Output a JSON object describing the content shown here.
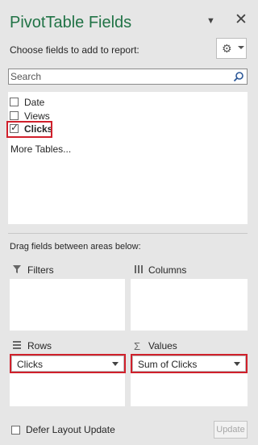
{
  "pane": {
    "title": "PivotTable Fields",
    "choose_label": "Choose fields to add to report:",
    "settings_icon": "gear-icon",
    "close_glyph": "✕"
  },
  "search": {
    "placeholder": "Search",
    "value": "",
    "icon": "search-icon"
  },
  "fields": [
    {
      "label": "Date",
      "checked": false
    },
    {
      "label": "Views",
      "checked": false
    },
    {
      "label": "Clicks",
      "checked": true
    }
  ],
  "more_tables": "More Tables...",
  "drag_label": "Drag fields between areas below:",
  "areas": {
    "filters": {
      "title": "Filters",
      "icon": "filter-icon"
    },
    "columns": {
      "title": "Columns",
      "icon": "columns-icon"
    },
    "rows": {
      "title": "Rows",
      "icon": "rows-icon",
      "items": [
        "Clicks"
      ]
    },
    "values": {
      "title": "Values",
      "icon": "sigma-icon",
      "items": [
        "Sum of Clicks"
      ]
    }
  },
  "footer": {
    "defer_label": "Defer Layout Update",
    "defer_checked": false,
    "update_label": "Update"
  },
  "colors": {
    "title_green": "#217346",
    "highlight_red": "#d0202b",
    "pane_bg": "#e6e6e6"
  }
}
